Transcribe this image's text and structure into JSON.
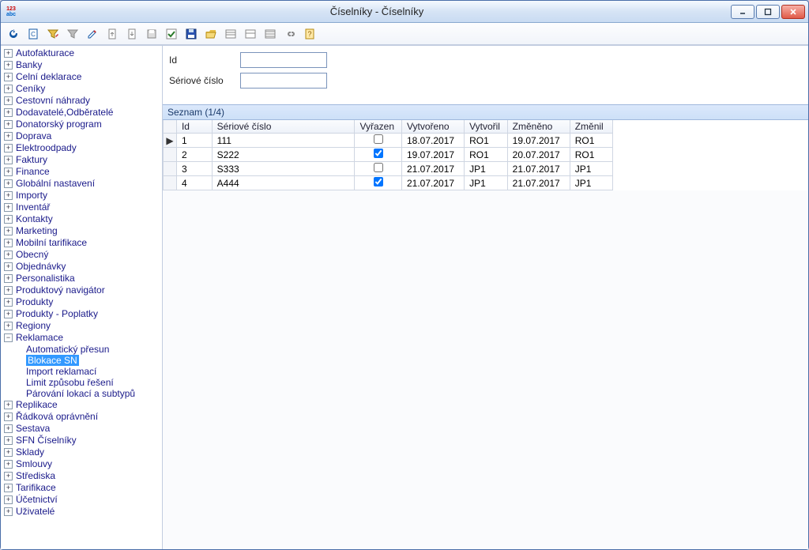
{
  "window": {
    "title": "Číselníky - Číselníky"
  },
  "toolbar": {
    "icons": [
      "refresh",
      "page-c",
      "funnel-edit",
      "funnel",
      "edit",
      "doc-up",
      "doc-down",
      "save-1",
      "check",
      "save-disk",
      "open-folder",
      "lines-1",
      "lines-2",
      "lines-3",
      "link",
      "help"
    ]
  },
  "form": {
    "id_label": "Id",
    "serial_label": "Sériové číslo",
    "id_value": "",
    "serial_value": ""
  },
  "list": {
    "header": "Seznam (1/4)",
    "columns": {
      "id": "Id",
      "serial": "Sériové číslo",
      "discarded": "Vyřazen",
      "created": "Vytvořeno",
      "created_by": "Vytvořil",
      "changed": "Změněno",
      "changed_by": "Změnil"
    },
    "rows": [
      {
        "id": "1",
        "serial": "111",
        "discarded": false,
        "created": "18.07.2017",
        "created_by": "RO1",
        "changed": "19.07.2017",
        "changed_by": "RO1",
        "current": true
      },
      {
        "id": "2",
        "serial": "S222",
        "discarded": true,
        "created": "19.07.2017",
        "created_by": "RO1",
        "changed": "20.07.2017",
        "changed_by": "RO1"
      },
      {
        "id": "3",
        "serial": "S333",
        "discarded": false,
        "created": "21.07.2017",
        "created_by": "JP1",
        "changed": "21.07.2017",
        "changed_by": "JP1"
      },
      {
        "id": "4",
        "serial": "A444",
        "discarded": true,
        "created": "21.07.2017",
        "created_by": "JP1",
        "changed": "21.07.2017",
        "changed_by": "JP1"
      }
    ]
  },
  "tree": [
    {
      "label": "Autofakturace"
    },
    {
      "label": "Banky"
    },
    {
      "label": "Celní deklarace"
    },
    {
      "label": "Ceníky"
    },
    {
      "label": "Cestovní náhrady"
    },
    {
      "label": "Dodavatelé,Odběratelé"
    },
    {
      "label": "Donatorský program"
    },
    {
      "label": "Doprava"
    },
    {
      "label": "Elektroodpady"
    },
    {
      "label": "Faktury"
    },
    {
      "label": "Finance"
    },
    {
      "label": "Globální nastavení"
    },
    {
      "label": "Importy"
    },
    {
      "label": "Inventář"
    },
    {
      "label": "Kontakty"
    },
    {
      "label": "Marketing"
    },
    {
      "label": "Mobilní tarifikace"
    },
    {
      "label": "Obecný"
    },
    {
      "label": "Objednávky"
    },
    {
      "label": "Personalistika"
    },
    {
      "label": "Produktový navigátor"
    },
    {
      "label": "Produkty"
    },
    {
      "label": "Produkty - Poplatky"
    },
    {
      "label": "Regiony"
    },
    {
      "label": "Reklamace",
      "expanded": true,
      "children": [
        {
          "label": "Automatický přesun"
        },
        {
          "label": "Blokace SN",
          "selected": true
        },
        {
          "label": "Import reklamací"
        },
        {
          "label": "Limit způsobu řešení"
        },
        {
          "label": "Párování lokací a subtypů"
        }
      ]
    },
    {
      "label": "Replikace"
    },
    {
      "label": "Řádková oprávnění"
    },
    {
      "label": "Sestava"
    },
    {
      "label": "SFN Číselníky"
    },
    {
      "label": "Sklady"
    },
    {
      "label": "Smlouvy"
    },
    {
      "label": "Střediska"
    },
    {
      "label": "Tarifikace"
    },
    {
      "label": "Účetnictví"
    },
    {
      "label": "Uživatelé"
    }
  ]
}
